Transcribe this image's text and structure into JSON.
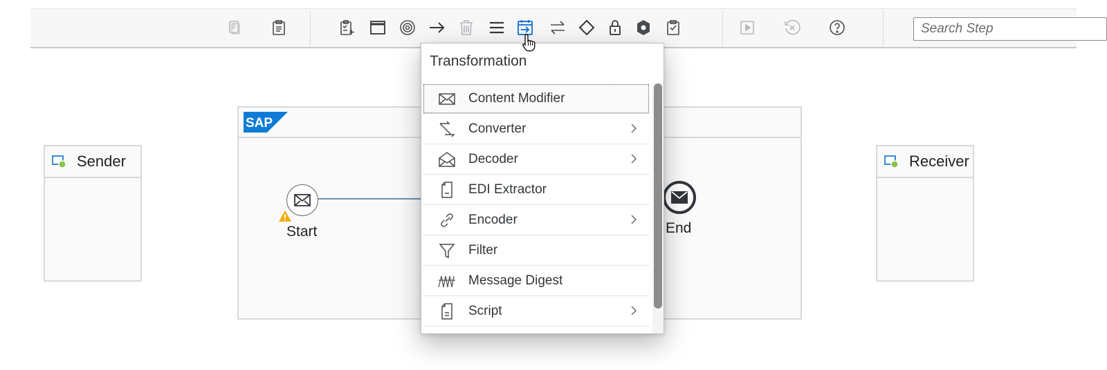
{
  "search": {
    "placeholder": "Search Step"
  },
  "toolbar": {
    "icons": [
      "copy-icon",
      "paste-icon",
      "participants-icon",
      "process-icon",
      "events-icon",
      "connector-icon",
      "delete-icon",
      "call-icon",
      "transformation-icon",
      "mediation-icon",
      "routing-icon",
      "security-icon",
      "persistence-icon",
      "validator-icon",
      "simulate-icon",
      "cancel-simulation-icon",
      "help-icon"
    ],
    "active": "transformation-icon"
  },
  "participants": {
    "sender": {
      "label": "Sender"
    },
    "receiver": {
      "label": "Receiver"
    }
  },
  "process": {
    "logo_text": "SAP",
    "start_label": "Start",
    "end_label": "End"
  },
  "menu": {
    "title": "Transformation",
    "items": [
      {
        "label": "Content Modifier",
        "icon": "envelope-icon",
        "submenu": false
      },
      {
        "label": "Converter",
        "icon": "converter-icon",
        "submenu": true
      },
      {
        "label": "Decoder",
        "icon": "open-envelope-icon",
        "submenu": true
      },
      {
        "label": "EDI Extractor",
        "icon": "document-icon",
        "submenu": false
      },
      {
        "label": "Encoder",
        "icon": "link-icon",
        "submenu": true
      },
      {
        "label": "Filter",
        "icon": "filter-icon",
        "submenu": false
      },
      {
        "label": "Message Digest",
        "icon": "digest-icon",
        "submenu": false
      },
      {
        "label": "Script",
        "icon": "script-icon",
        "submenu": true
      }
    ]
  },
  "colors": {
    "accent": "#0a6ed1",
    "warning": "#f0ab00",
    "icon": "#4a4d50",
    "disabled_icon": "#b5b8bb",
    "sap_blue": "#0f7bd7"
  }
}
